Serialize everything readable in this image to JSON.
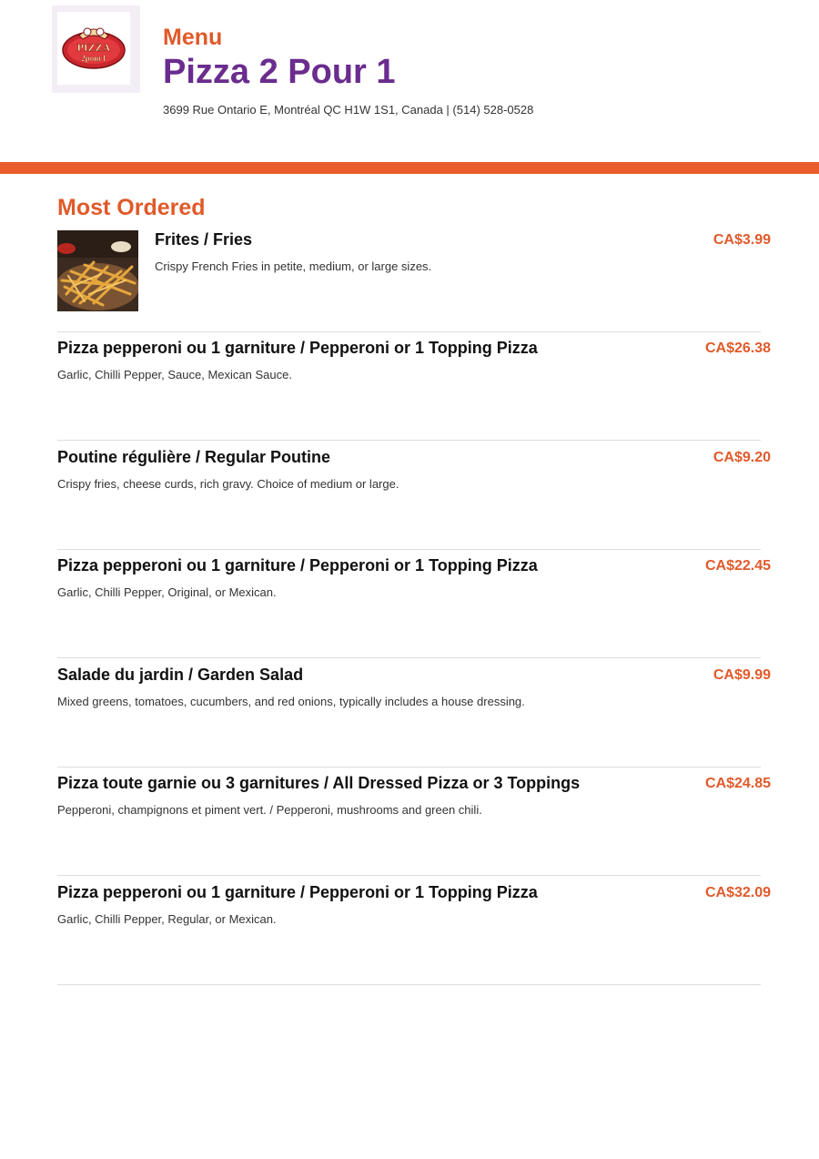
{
  "header": {
    "menu_label": "Menu",
    "restaurant_name": "Pizza 2 Pour 1",
    "address": "3699 Rue Ontario E, Montréal QC H1W 1S1, Canada | (514) 528-0528",
    "logo_text_top": "PIZZA",
    "logo_text_bottom": "2pour1"
  },
  "colors": {
    "accent_orange": "#e05a2a",
    "band_orange": "#e85d2b",
    "brand_purple": "#6a2c8e"
  },
  "section": {
    "title": "Most Ordered"
  },
  "items": [
    {
      "name": "Frites / Fries",
      "description": "Crispy French Fries in petite, medium, or large sizes.",
      "price": "CA$3.99",
      "image": "fries-photo"
    },
    {
      "name": "Pizza pepperoni ou 1 garniture / Pepperoni or 1 Topping Pizza",
      "description": "Garlic, Chilli Pepper, Sauce, Mexican Sauce.",
      "price": "CA$26.38"
    },
    {
      "name": "Poutine régulière / Regular Poutine",
      "description": "Crispy fries, cheese curds, rich gravy. Choice of medium or large.",
      "price": "CA$9.20"
    },
    {
      "name": "Pizza pepperoni ou 1 garniture / Pepperoni or 1 Topping Pizza",
      "description": "Garlic, Chilli Pepper, Original, or Mexican.",
      "price": "CA$22.45"
    },
    {
      "name": "Salade du jardin / Garden Salad",
      "description": "Mixed greens, tomatoes, cucumbers, and red onions, typically includes a house dressing.",
      "price": "CA$9.99"
    },
    {
      "name": "Pizza toute garnie ou 3 garnitures / All Dressed Pizza or 3 Toppings",
      "description": "Pepperoni, champignons et piment vert. / Pepperoni, mushrooms and green chili.",
      "price": "CA$24.85"
    },
    {
      "name": "Pizza pepperoni ou 1 garniture / Pepperoni or 1 Topping Pizza",
      "description": "Garlic, Chilli Pepper, Regular, or Mexican.",
      "price": "CA$32.09"
    }
  ]
}
